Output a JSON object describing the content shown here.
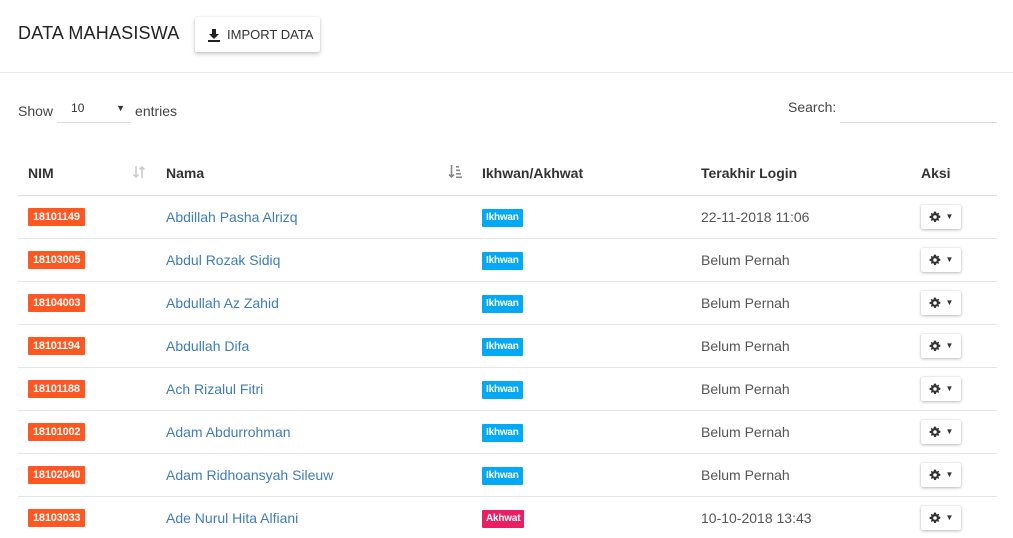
{
  "header": {
    "title": "DATA MAHASISWA",
    "import_label": "IMPORT DATA"
  },
  "controls": {
    "show_label": "Show",
    "page_size": "10",
    "entries_label": "entries",
    "search_label": "Search:",
    "search_value": ""
  },
  "table": {
    "columns": [
      "NIM",
      "Nama",
      "Ikhwan/Akhwat",
      "Terakhir Login",
      "Aksi"
    ],
    "rows": [
      {
        "nim": "18101149",
        "nama": "Abdillah Pasha Alrizq",
        "gender": "Ikhwan",
        "login": "22-11-2018 11:06"
      },
      {
        "nim": "18103005",
        "nama": "Abdul Rozak Sidiq",
        "gender": "Ikhwan",
        "login": "Belum Pernah"
      },
      {
        "nim": "18104003",
        "nama": "Abdullah Az Zahid",
        "gender": "Ikhwan",
        "login": "Belum Pernah"
      },
      {
        "nim": "18101194",
        "nama": "Abdullah Difa",
        "gender": "Ikhwan",
        "login": "Belum Pernah"
      },
      {
        "nim": "18101188",
        "nama": "Ach Rizalul Fitri",
        "gender": "Ikhwan",
        "login": "Belum Pernah"
      },
      {
        "nim": "18101002",
        "nama": "Adam Abdurrohman",
        "gender": "Ikhwan",
        "login": "Belum Pernah"
      },
      {
        "nim": "18102040",
        "nama": "Adam Ridhoansyah Sileuw",
        "gender": "Ikhwan",
        "login": "Belum Pernah"
      },
      {
        "nim": "18103033",
        "nama": "Ade Nurul Hita Alfiani",
        "gender": "Akhwat",
        "login": "10-10-2018 13:43"
      }
    ]
  },
  "colors": {
    "nim_badge": "#ff5722",
    "ikhwan_badge": "#03a9f4",
    "akhwat_badge": "#e91e63",
    "link": "#3f7dbd"
  }
}
